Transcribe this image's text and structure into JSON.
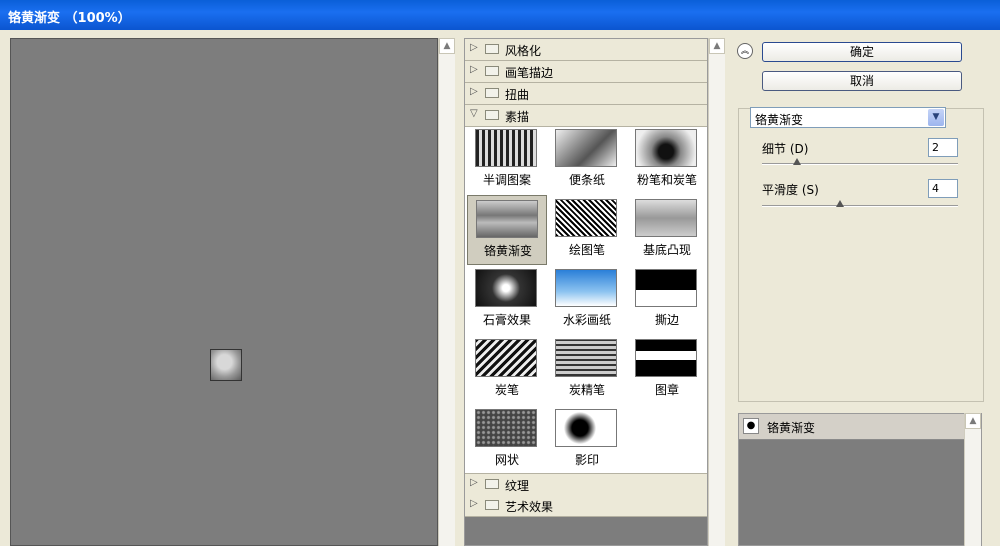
{
  "window": {
    "title": "铬黄渐变 （100%）"
  },
  "categories_top": [
    {
      "label": "风格化"
    },
    {
      "label": "画笔描边"
    },
    {
      "label": "扭曲"
    },
    {
      "label": "素描"
    }
  ],
  "categories_bottom": [
    {
      "label": "纹理"
    },
    {
      "label": "艺术效果"
    }
  ],
  "filters": [
    {
      "label": "半调图案"
    },
    {
      "label": "便条纸"
    },
    {
      "label": "粉笔和炭笔"
    },
    {
      "label": "铬黄渐变"
    },
    {
      "label": "绘图笔"
    },
    {
      "label": "基底凸现"
    },
    {
      "label": "石膏效果"
    },
    {
      "label": "水彩画纸"
    },
    {
      "label": "撕边"
    },
    {
      "label": "炭笔"
    },
    {
      "label": "炭精笔"
    },
    {
      "label": "图章"
    },
    {
      "label": "网状"
    },
    {
      "label": "影印"
    }
  ],
  "selected_filter": "铬黄渐变",
  "buttons": {
    "ok": "确定",
    "cancel": "取消"
  },
  "filter_select": {
    "value": "铬黄渐变"
  },
  "params": [
    {
      "label": "细节 (D)",
      "value": "2",
      "slider_fraction": 0.18
    },
    {
      "label": "平滑度 (S)",
      "value": "4",
      "slider_fraction": 0.4
    }
  ],
  "layers": [
    {
      "label": "铬黄渐变"
    }
  ],
  "icons": {
    "eye": "eye-icon",
    "folder": "folder-icon",
    "collapse": "double-chevron-up-icon",
    "dropdown": "chevron-down-icon"
  }
}
